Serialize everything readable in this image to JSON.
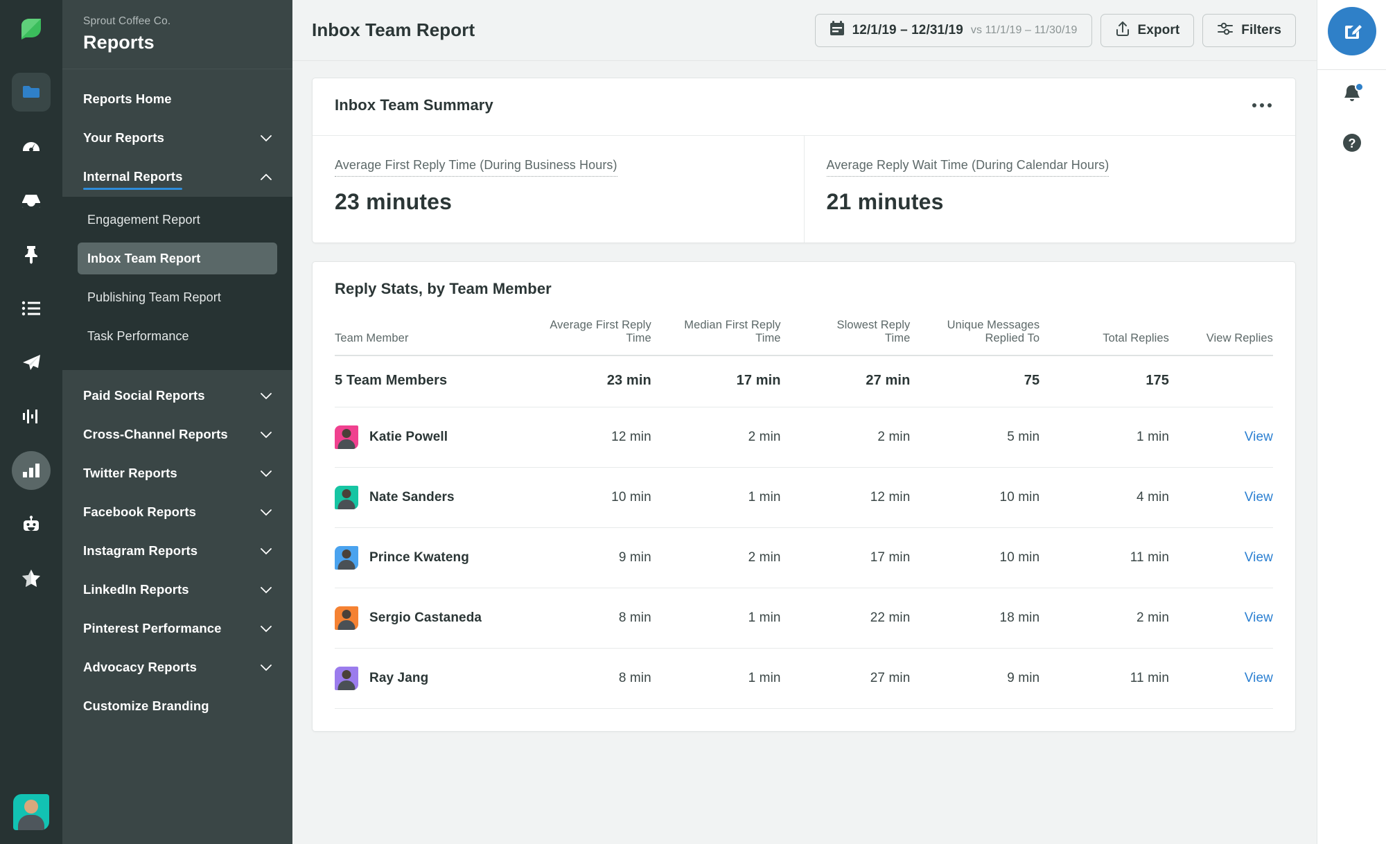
{
  "rail": {
    "logo": "sprout-leaf-logo",
    "items": [
      {
        "name": "folder-icon",
        "state": "boxed"
      },
      {
        "name": "dashboard-gauge-icon",
        "state": "plain"
      },
      {
        "name": "inbox-tray-icon",
        "state": "plain"
      },
      {
        "name": "pin-icon",
        "state": "plain"
      },
      {
        "name": "list-icon",
        "state": "plain"
      },
      {
        "name": "publish-send-icon",
        "state": "plain"
      },
      {
        "name": "listening-waveform-icon",
        "state": "plain"
      },
      {
        "name": "reports-bar-chart-icon",
        "state": "round"
      },
      {
        "name": "bot-icon",
        "state": "plain"
      },
      {
        "name": "star-icon",
        "state": "plain"
      }
    ],
    "avatar": "user-avatar"
  },
  "nav": {
    "org": "Sprout Coffee Co.",
    "title": "Reports",
    "home_label": "Reports Home",
    "groups": [
      {
        "label": "Your Reports",
        "expanded": false,
        "chevron": "chevron-down-icon"
      },
      {
        "label": "Internal Reports",
        "expanded": true,
        "chevron": "chevron-up-icon"
      }
    ],
    "internal_items": [
      {
        "label": "Engagement Report",
        "selected": false
      },
      {
        "label": "Inbox Team Report",
        "selected": true
      },
      {
        "label": "Publishing Team Report",
        "selected": false
      },
      {
        "label": "Task Performance",
        "selected": false
      }
    ],
    "more_groups": [
      {
        "label": "Paid Social Reports",
        "chevron": "chevron-down-icon"
      },
      {
        "label": "Cross-Channel Reports",
        "chevron": "chevron-down-icon"
      },
      {
        "label": "Twitter Reports",
        "chevron": "chevron-down-icon"
      },
      {
        "label": "Facebook Reports",
        "chevron": "chevron-down-icon"
      },
      {
        "label": "Instagram Reports",
        "chevron": "chevron-down-icon"
      },
      {
        "label": "LinkedIn Reports",
        "chevron": "chevron-down-icon"
      },
      {
        "label": "Pinterest Performance",
        "chevron": "chevron-down-icon"
      },
      {
        "label": "Advocacy Reports",
        "chevron": "chevron-down-icon"
      }
    ],
    "customize_label": "Customize Branding"
  },
  "topbar": {
    "page_title": "Inbox Team Report",
    "date_range": "12/1/19 – 12/31/19",
    "date_compare": "vs 11/1/19 – 11/30/19",
    "export_label": "Export",
    "filters_label": "Filters"
  },
  "summary_card": {
    "title": "Inbox Team Summary",
    "menu": "more-options-icon",
    "metrics": [
      {
        "label": "Average First Reply Time (During Business Hours)",
        "value": "23 minutes"
      },
      {
        "label": "Average Reply Wait Time (During Calendar Hours)",
        "value": "21 minutes"
      }
    ]
  },
  "stats_card": {
    "title": "Reply Stats, by Team Member",
    "columns": [
      {
        "l1": "",
        "l2": "Team Member"
      },
      {
        "l1": "Average First Reply",
        "l2": "Time"
      },
      {
        "l1": "Median First Reply",
        "l2": "Time"
      },
      {
        "l1": "Slowest Reply",
        "l2": "Time"
      },
      {
        "l1": "Unique Messages",
        "l2": "Replied To"
      },
      {
        "l1": "",
        "l2": "Total Replies"
      },
      {
        "l1": "",
        "l2": "View Replies"
      }
    ],
    "summary_row": {
      "name": "5 Team Members",
      "avg_first_reply": "23 min",
      "median_first_reply": "17 min",
      "slowest_reply": "27 min",
      "unique_messages": "75",
      "total_replies": "175",
      "view": ""
    },
    "view_label": "View",
    "rows": [
      {
        "name": "Katie Powell",
        "avatar_color": "#f0418f",
        "avg_first_reply": "12 min",
        "median_first_reply": "2 min",
        "slowest_reply": "2 min",
        "unique_messages": "5 min",
        "total_replies": "1 min"
      },
      {
        "name": "Nate Sanders",
        "avatar_color": "#16c5a3",
        "avg_first_reply": "10 min",
        "median_first_reply": "1 min",
        "slowest_reply": "12 min",
        "unique_messages": "10 min",
        "total_replies": "4 min"
      },
      {
        "name": "Prince Kwateng",
        "avatar_color": "#4aa3ef",
        "avg_first_reply": "9 min",
        "median_first_reply": "2 min",
        "slowest_reply": "17 min",
        "unique_messages": "10 min",
        "total_replies": "11 min"
      },
      {
        "name": "Sergio Castaneda",
        "avatar_color": "#f58233",
        "avg_first_reply": "8 min",
        "median_first_reply": "1 min",
        "slowest_reply": "22 min",
        "unique_messages": "18 min",
        "total_replies": "2 min"
      },
      {
        "name": "Ray Jang",
        "avatar_color": "#9b7ced",
        "avg_first_reply": "8 min",
        "median_first_reply": "1 min",
        "slowest_reply": "27 min",
        "unique_messages": "9 min",
        "total_replies": "11 min"
      }
    ]
  },
  "right_rail": {
    "compose": "compose-edit-icon",
    "notifications": "bell-icon",
    "help": "help-question-icon"
  },
  "colors": {
    "accent_blue": "#2f80c8",
    "link_blue": "#2a7fd1",
    "rail_dark": "#273333",
    "nav_dark": "#3a4646",
    "page_bg": "#f1f3f3"
  }
}
